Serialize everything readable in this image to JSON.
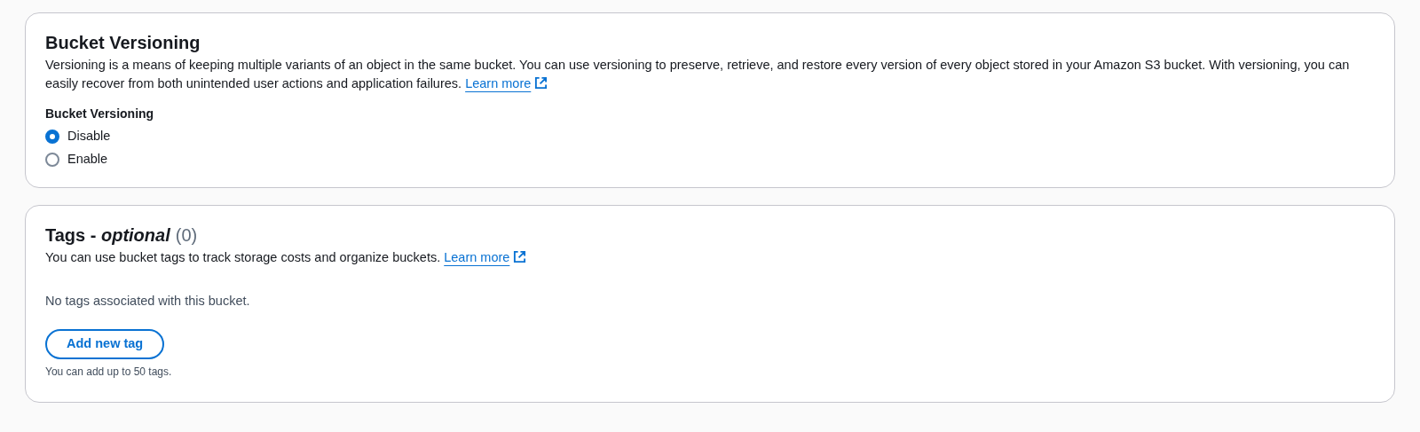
{
  "versioning": {
    "title": "Bucket Versioning",
    "description": "Versioning is a means of keeping multiple variants of an object in the same bucket. You can use versioning to preserve, retrieve, and restore every version of every object stored in your Amazon S3 bucket. With versioning, you can easily recover from both unintended user actions and application failures.",
    "link": "Learn more",
    "field_label": "Bucket Versioning",
    "options": [
      {
        "label": "Disable",
        "selected": true
      },
      {
        "label": "Enable",
        "selected": false
      }
    ]
  },
  "tags": {
    "title": "Tags - *optional*",
    "count": "(0)",
    "description": "You can use bucket tags to track storage costs and organize buckets.",
    "link": "Learn more",
    "empty_message": "No tags associated with this bucket.",
    "button": "Add new tag",
    "hint": "You can add up to 50 tags."
  }
}
